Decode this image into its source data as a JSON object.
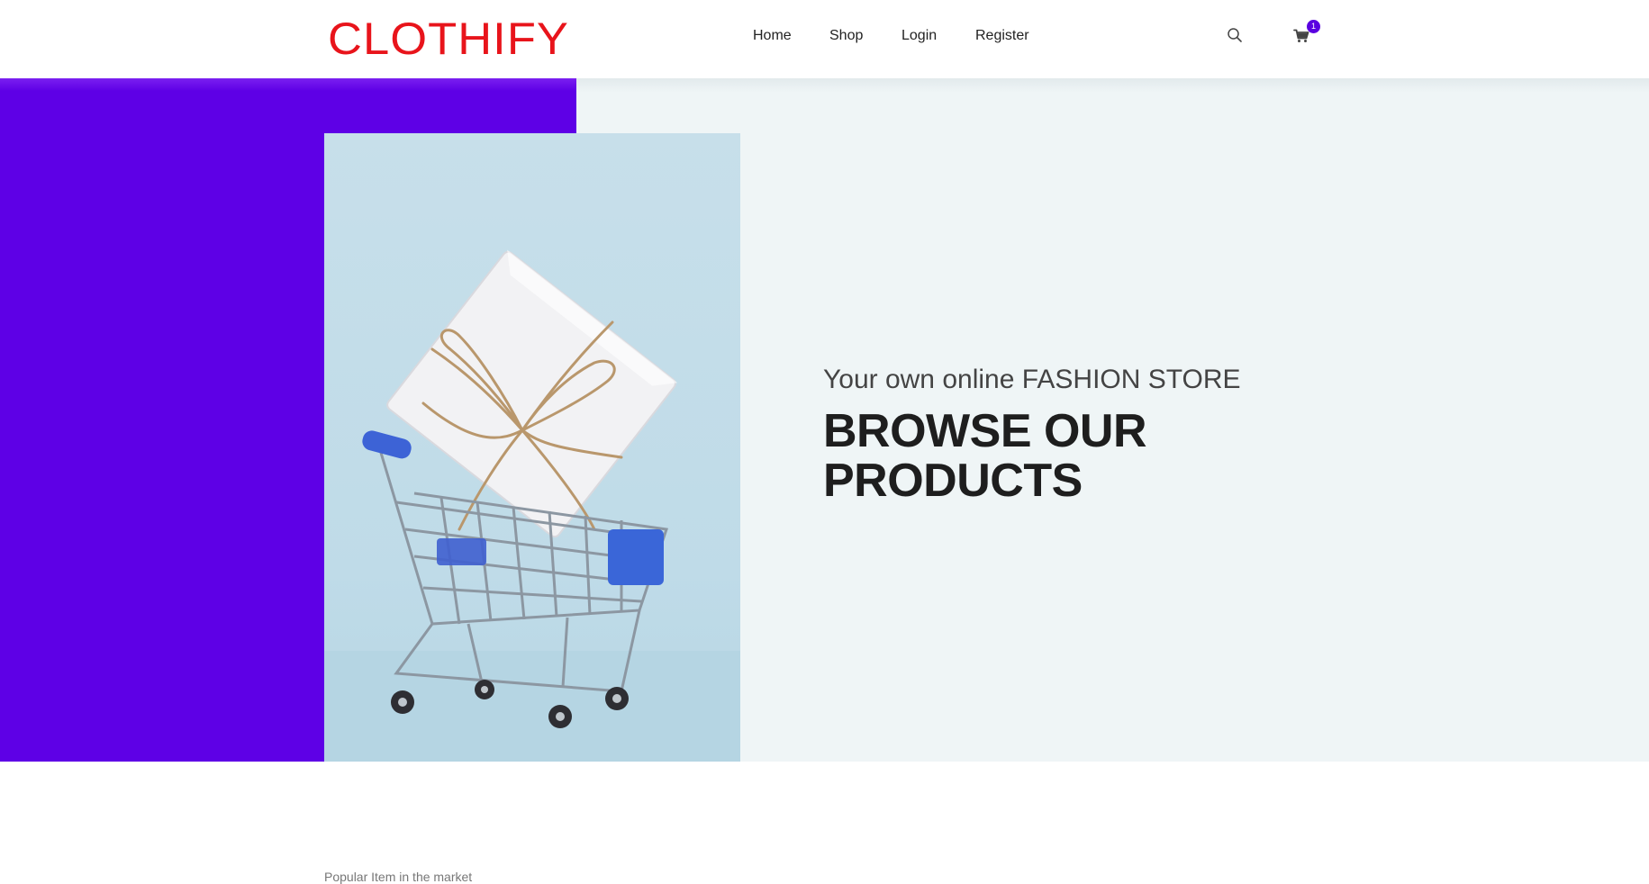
{
  "brand": {
    "logo_text": "CLOTHIFY",
    "logo_color": "#e8141b"
  },
  "nav": {
    "items": [
      {
        "label": "Home"
      },
      {
        "label": "Shop"
      },
      {
        "label": "Login"
      },
      {
        "label": "Register"
      }
    ]
  },
  "header_icons": {
    "search_icon": "search-icon",
    "cart_icon": "cart-icon",
    "cart_count": "1"
  },
  "hero": {
    "subtitle": "Your own online FASHION STORE",
    "title_line1": "BROWSE OUR",
    "title_line2": "PRODUCTS",
    "accent_color": "#5e00e6",
    "image": "shopping-cart-with-gift-box"
  },
  "section": {
    "caption": "Popular Item in the market"
  }
}
